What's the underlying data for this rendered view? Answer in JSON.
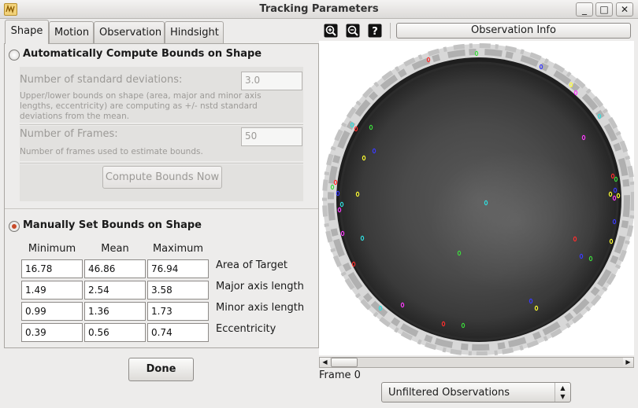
{
  "window": {
    "title": "Tracking Parameters",
    "controls": [
      "_",
      "□",
      "✕"
    ]
  },
  "tabs": [
    {
      "label": "Shape",
      "active": true
    },
    {
      "label": "Motion",
      "active": false
    },
    {
      "label": "Observation",
      "active": false
    },
    {
      "label": "Hindsight",
      "active": false
    }
  ],
  "auto": {
    "radio_label": "Automatically Compute Bounds on Shape",
    "selected": false,
    "nstd_label": "Number of standard deviations:",
    "nstd_value": "3.0",
    "nstd_desc_1": "Upper/lower bounds on shape (area, major and minor axis",
    "nstd_desc_2": "lengths, eccentricity) are computing as +/- nstd standard",
    "nstd_desc_3": "deviations from the mean.",
    "frames_label": "Number of Frames:",
    "frames_value": "50",
    "frames_desc": "Number of frames used to estimate bounds.",
    "compute_button": "Compute Bounds Now"
  },
  "manual": {
    "radio_label": "Manually Set Bounds on Shape",
    "selected": true,
    "columns": [
      "Minimum",
      "Mean",
      "Maximum"
    ],
    "rows": [
      {
        "label": "Area of Target",
        "min": "16.78",
        "mean": "46.86",
        "max": "76.94"
      },
      {
        "label": "Major axis length",
        "min": "1.49",
        "mean": "2.54",
        "max": "3.58"
      },
      {
        "label": "Minor axis length",
        "min": "0.99",
        "mean": "1.36",
        "max": "1.73"
      },
      {
        "label": "Eccentricity",
        "min": "0.39",
        "mean": "0.56",
        "max": "0.74"
      }
    ]
  },
  "done_button": "Done",
  "toolbar": {
    "zoom_in_icon": "zoom-in-icon",
    "zoom_out_icon": "zoom-out-icon",
    "help_icon": "help-icon",
    "observation_info_button": "Observation Info"
  },
  "viewer": {
    "frame_label": "Frame 0",
    "filter_value": "Unfiltered Observations",
    "target_colors": [
      "#ff2d2d",
      "#3cdc3c",
      "#3a3aff",
      "#ffff30",
      "#ff3cff",
      "#30e0e0"
    ]
  }
}
